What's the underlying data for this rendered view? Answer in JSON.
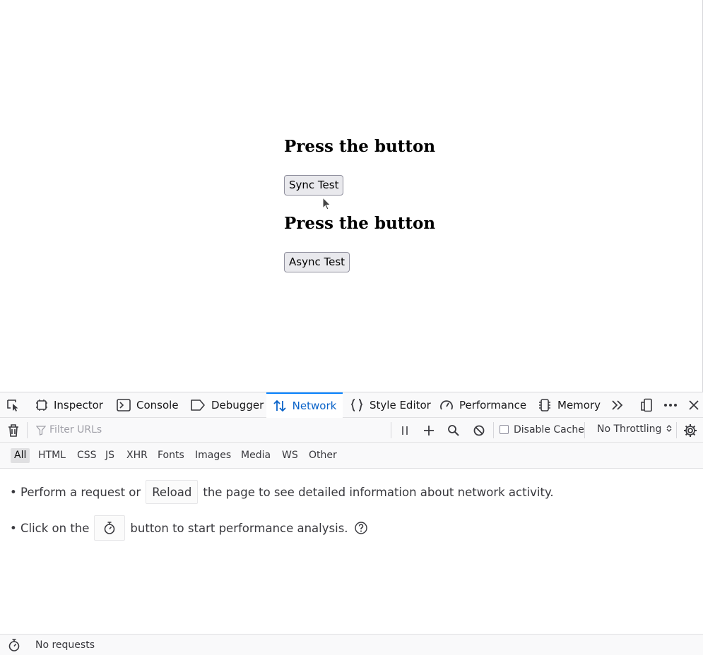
{
  "page": {
    "heading1": "Press the button",
    "button1": "Sync Test",
    "heading2": "Press the button",
    "button2": "Async Test"
  },
  "devtools": {
    "tabs": [
      {
        "label": "Inspector",
        "icon": "inspector-icon"
      },
      {
        "label": "Console",
        "icon": "console-icon"
      },
      {
        "label": "Debugger",
        "icon": "debugger-icon"
      },
      {
        "label": "Network",
        "icon": "network-icon",
        "active": true
      },
      {
        "label": "Style Editor",
        "icon": "style-editor-icon"
      },
      {
        "label": "Performance",
        "icon": "performance-icon"
      },
      {
        "label": "Memory",
        "icon": "memory-icon"
      }
    ],
    "accent_color": "#0a84ff",
    "network": {
      "filter_placeholder": "Filter URLs",
      "disable_cache_label": "Disable Cache",
      "disable_cache_checked": false,
      "throttling": "No Throttling",
      "types": [
        "All",
        "HTML",
        "CSS",
        "JS",
        "XHR",
        "Fonts",
        "Images",
        "Media",
        "WS",
        "Other"
      ],
      "active_type": "All",
      "notice1_before": "• Perform a request or",
      "reload_label": "Reload",
      "notice1_after": "the page to see detailed information about network activity.",
      "notice2_before": "• Click on the",
      "notice2_after": "button to start performance analysis.",
      "status": "No requests"
    }
  }
}
